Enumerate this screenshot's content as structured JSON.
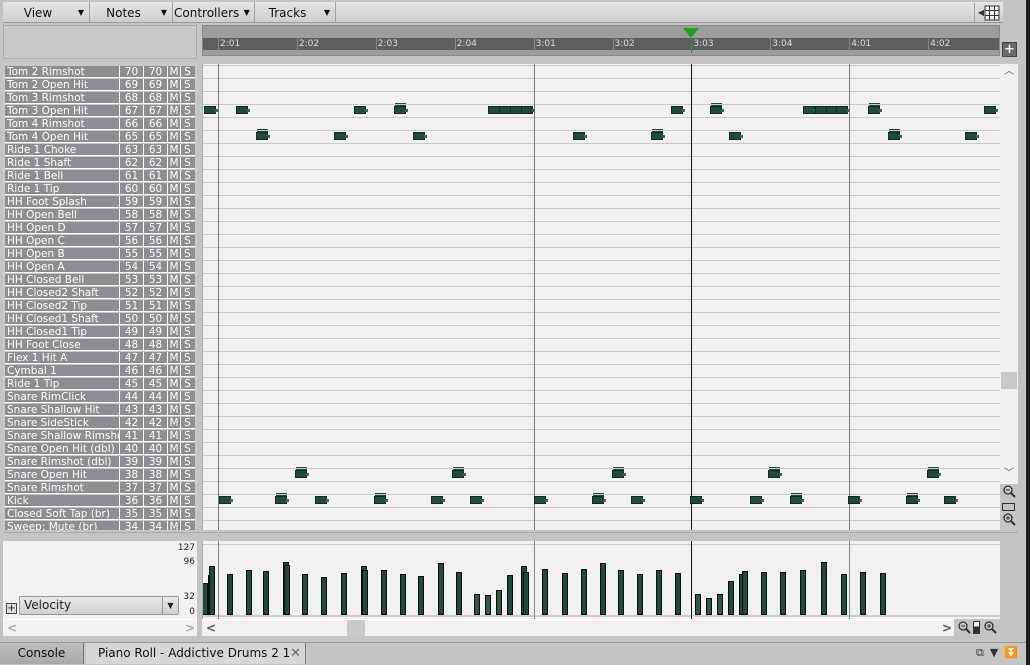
{
  "menubar": {
    "menus": [
      {
        "label": "View"
      },
      {
        "label": "Notes"
      },
      {
        "label": "Controllers"
      },
      {
        "label": "Tracks"
      }
    ]
  },
  "timeline": {
    "markers": [
      "2:01",
      "2:02",
      "2:03",
      "2:04",
      "3:01",
      "3:02",
      "3:03",
      "3:04",
      "4:01",
      "4:02"
    ],
    "playhead": "3:03",
    "playhead_color": "#1aa31a"
  },
  "keys": [
    {
      "name": "Tom 2 Rimshot",
      "n1": "70",
      "n2": "70",
      "m": "M",
      "s": "S"
    },
    {
      "name": "Tom 2 Open Hit",
      "n1": "69",
      "n2": "69",
      "m": "M",
      "s": "S"
    },
    {
      "name": "Tom 3 Rimshot",
      "n1": "68",
      "n2": "68",
      "m": "M",
      "s": "S"
    },
    {
      "name": "Tom 3 Open Hit",
      "n1": "67",
      "n2": "67",
      "m": "M",
      "s": "S"
    },
    {
      "name": "Tom 4 Rimshot",
      "n1": "66",
      "n2": "66",
      "m": "M",
      "s": "S"
    },
    {
      "name": "Tom 4 Open Hit",
      "n1": "65",
      "n2": "65",
      "m": "M",
      "s": "S"
    },
    {
      "name": "Ride 1 Choke",
      "n1": "63",
      "n2": "63",
      "m": "M",
      "s": "S"
    },
    {
      "name": "Ride 1 Shaft",
      "n1": "62",
      "n2": "62",
      "m": "M",
      "s": "S"
    },
    {
      "name": "Ride 1 Bell",
      "n1": "61",
      "n2": "61",
      "m": "M",
      "s": "S"
    },
    {
      "name": "Ride 1 Tip",
      "n1": "60",
      "n2": "60",
      "m": "M",
      "s": "S"
    },
    {
      "name": "HH Foot Splash",
      "n1": "59",
      "n2": "59",
      "m": "M",
      "s": "S"
    },
    {
      "name": "HH Open Bell",
      "n1": "58",
      "n2": "58",
      "m": "M",
      "s": "S"
    },
    {
      "name": "HH Open D",
      "n1": "57",
      "n2": "57",
      "m": "M",
      "s": "S"
    },
    {
      "name": "HH Open C",
      "n1": "56",
      "n2": "56",
      "m": "M",
      "s": "S"
    },
    {
      "name": "HH Open B",
      "n1": "55",
      "n2": "55",
      "m": "M",
      "s": "S"
    },
    {
      "name": "HH Open A",
      "n1": "54",
      "n2": "54",
      "m": "M",
      "s": "S"
    },
    {
      "name": "HH Closed Bell",
      "n1": "53",
      "n2": "53",
      "m": "M",
      "s": "S"
    },
    {
      "name": "HH Closed2 Shaft",
      "n1": "52",
      "n2": "52",
      "m": "M",
      "s": "S"
    },
    {
      "name": "HH Closed2 Tip",
      "n1": "51",
      "n2": "51",
      "m": "M",
      "s": "S"
    },
    {
      "name": "HH Closed1 Shaft",
      "n1": "50",
      "n2": "50",
      "m": "M",
      "s": "S"
    },
    {
      "name": "HH Closed1 Tip",
      "n1": "49",
      "n2": "49",
      "m": "M",
      "s": "S"
    },
    {
      "name": "HH Foot Close",
      "n1": "48",
      "n2": "48",
      "m": "M",
      "s": "S"
    },
    {
      "name": "Flex 1 Hit A",
      "n1": "47",
      "n2": "47",
      "m": "M",
      "s": "S"
    },
    {
      "name": "Cymbal 1",
      "n1": "46",
      "n2": "46",
      "m": "M",
      "s": "S"
    },
    {
      "name": "Ride 1 Tip",
      "n1": "45",
      "n2": "45",
      "m": "M",
      "s": "S"
    },
    {
      "name": "Snare RimClick",
      "n1": "44",
      "n2": "44",
      "m": "M",
      "s": "S"
    },
    {
      "name": "Snare Shallow Hit",
      "n1": "43",
      "n2": "43",
      "m": "M",
      "s": "S"
    },
    {
      "name": "Snare SideStick",
      "n1": "42",
      "n2": "42",
      "m": "M",
      "s": "S"
    },
    {
      "name": "Snare Shallow Rimshot",
      "n1": "41",
      "n2": "41",
      "m": "M",
      "s": "S"
    },
    {
      "name": "Snare Open Hit (dbl)",
      "n1": "40",
      "n2": "40",
      "m": "M",
      "s": "S"
    },
    {
      "name": "Snare Rimshot (dbl)",
      "n1": "39",
      "n2": "39",
      "m": "M",
      "s": "S"
    },
    {
      "name": "Snare Open Hit",
      "n1": "38",
      "n2": "38",
      "m": "M",
      "s": "S"
    },
    {
      "name": "Snare Rimshot",
      "n1": "37",
      "n2": "37",
      "m": "M",
      "s": "S"
    },
    {
      "name": "Kick",
      "n1": "36",
      "n2": "36",
      "m": "M",
      "s": "S"
    },
    {
      "name": "Closed Soft Tap (br)",
      "n1": "35",
      "n2": "35",
      "m": "M",
      "s": "S"
    },
    {
      "name": "Sweep: Mute (br)",
      "n1": "34",
      "n2": "34",
      "m": "M",
      "s": "S"
    }
  ],
  "notes": [
    {
      "row": 3,
      "beat": -0.17,
      "accent": false
    },
    {
      "row": 3,
      "beat": 0.24,
      "accent": false
    },
    {
      "row": 3,
      "beat": 1.74,
      "accent": false
    },
    {
      "row": 3,
      "beat": 2.24,
      "accent": true
    },
    {
      "row": 3,
      "beat": 3.43,
      "accent": false
    },
    {
      "row": 3,
      "beat": 3.57,
      "accent": false
    },
    {
      "row": 3,
      "beat": 3.71,
      "accent": false
    },
    {
      "row": 3,
      "beat": 3.85,
      "accent": false
    },
    {
      "row": 3,
      "beat": 5.75,
      "accent": false
    },
    {
      "row": 3,
      "beat": 6.25,
      "accent": true
    },
    {
      "row": 3,
      "beat": 7.43,
      "accent": false
    },
    {
      "row": 3,
      "beat": 7.58,
      "accent": false
    },
    {
      "row": 3,
      "beat": 7.72,
      "accent": false
    },
    {
      "row": 3,
      "beat": 7.85,
      "accent": false
    },
    {
      "row": 3,
      "beat": 8.25,
      "accent": true
    },
    {
      "row": 3,
      "beat": 9.72,
      "accent": false
    },
    {
      "row": 5,
      "beat": 0.5,
      "accent": true
    },
    {
      "row": 5,
      "beat": 1.48,
      "accent": false
    },
    {
      "row": 5,
      "beat": 2.48,
      "accent": false
    },
    {
      "row": 5,
      "beat": 4.51,
      "accent": false
    },
    {
      "row": 5,
      "beat": 5.5,
      "accent": true
    },
    {
      "row": 5,
      "beat": 6.49,
      "accent": false
    },
    {
      "row": 5,
      "beat": 8.5,
      "accent": true
    },
    {
      "row": 5,
      "beat": 9.48,
      "accent": false
    },
    {
      "row": 31,
      "beat": 0.99,
      "accent": true
    },
    {
      "row": 31,
      "beat": 2.98,
      "accent": true
    },
    {
      "row": 31,
      "beat": 5.0,
      "accent": true
    },
    {
      "row": 31,
      "beat": 6.98,
      "accent": true
    },
    {
      "row": 31,
      "beat": 9.0,
      "accent": true
    },
    {
      "row": 33,
      "beat": 0.02,
      "accent": false
    },
    {
      "row": 33,
      "beat": 0.74,
      "accent": true
    },
    {
      "row": 33,
      "beat": 1.24,
      "accent": false
    },
    {
      "row": 33,
      "beat": 1.99,
      "accent": true
    },
    {
      "row": 33,
      "beat": 2.71,
      "accent": false
    },
    {
      "row": 33,
      "beat": 3.21,
      "accent": false
    },
    {
      "row": 33,
      "beat": 4.02,
      "accent": false
    },
    {
      "row": 33,
      "beat": 4.75,
      "accent": true
    },
    {
      "row": 33,
      "beat": 5.25,
      "accent": false
    },
    {
      "row": 33,
      "beat": 6.0,
      "accent": false
    },
    {
      "row": 33,
      "beat": 6.76,
      "accent": false
    },
    {
      "row": 33,
      "beat": 7.26,
      "accent": true
    },
    {
      "row": 33,
      "beat": 8.0,
      "accent": false
    },
    {
      "row": 33,
      "beat": 8.73,
      "accent": true
    },
    {
      "row": 33,
      "beat": 9.22,
      "accent": false
    }
  ],
  "controller": {
    "lane": "Velocity",
    "y_labels": [
      "127",
      "96",
      "32",
      "0"
    ],
    "bars": [
      {
        "beat": -0.12,
        "v": 58,
        "light": false
      },
      {
        "beat": 0.03,
        "v": 73,
        "light": false
      },
      {
        "beat": 0.05,
        "v": 88,
        "light": false
      },
      {
        "beat": 0.5,
        "v": 75,
        "light": false
      },
      {
        "beat": 0.99,
        "v": 81,
        "light": false
      },
      {
        "beat": 1.43,
        "v": 79,
        "light": false
      },
      {
        "beat": 1.93,
        "v": 96,
        "light": false
      },
      {
        "beat": 1.95,
        "v": 90,
        "light": false
      },
      {
        "beat": 2.42,
        "v": 75,
        "light": false
      },
      {
        "beat": 2.9,
        "v": 69,
        "light": false
      },
      {
        "beat": 3.4,
        "v": 77,
        "light": false
      },
      {
        "beat": 3.9,
        "v": 88,
        "light": false
      },
      {
        "beat": 3.92,
        "v": 82,
        "light": false
      },
      {
        "beat": 4.41,
        "v": 81,
        "light": false
      },
      {
        "beat": 4.89,
        "v": 75,
        "light": false
      },
      {
        "beat": 5.34,
        "v": 71,
        "light": false
      },
      {
        "beat": 5.85,
        "v": 94,
        "light": false
      },
      {
        "beat": 6.3,
        "v": 78,
        "light": false
      },
      {
        "beat": 6.76,
        "v": 39,
        "light": true
      },
      {
        "beat": 7.04,
        "v": 37,
        "light": true
      },
      {
        "beat": 7.32,
        "v": 45,
        "light": true
      },
      {
        "beat": 7.6,
        "v": 73,
        "light": false
      },
      {
        "beat": 7.97,
        "v": 88,
        "light": false
      },
      {
        "beat": 8.0,
        "v": 78,
        "light": false
      },
      {
        "beat": 8.5,
        "v": 83,
        "light": false
      },
      {
        "beat": 8.99,
        "v": 77,
        "light": false
      },
      {
        "beat": 9.47,
        "v": 83,
        "light": false
      },
      {
        "beat": 9.95,
        "v": 95,
        "light": false
      },
      {
        "beat": 10.42,
        "v": 81,
        "light": false
      },
      {
        "beat": 10.9,
        "v": 75,
        "light": false
      },
      {
        "beat": 11.39,
        "v": 81,
        "light": false
      },
      {
        "beat": 11.87,
        "v": 77,
        "light": false
      },
      {
        "beat": 12.37,
        "v": 39,
        "light": true
      },
      {
        "beat": 12.66,
        "v": 31,
        "light": true
      },
      {
        "beat": 12.94,
        "v": 38,
        "light": true
      },
      {
        "beat": 13.2,
        "v": 61,
        "light": false
      },
      {
        "beat": 13.49,
        "v": 74,
        "light": false
      },
      {
        "beat": 13.56,
        "v": 79,
        "light": false
      },
      {
        "beat": 14.04,
        "v": 78,
        "light": false
      },
      {
        "beat": 14.53,
        "v": 78,
        "light": false
      },
      {
        "beat": 15.02,
        "v": 81,
        "light": false
      },
      {
        "beat": 15.57,
        "v": 96,
        "light": false
      },
      {
        "beat": 16.06,
        "v": 75,
        "light": false
      },
      {
        "beat": 16.56,
        "v": 78,
        "light": false
      },
      {
        "beat": 17.06,
        "v": 77,
        "light": false
      }
    ]
  },
  "tabs": [
    {
      "label": "Console"
    },
    {
      "label": "Piano Roll - Addictive Drums 2 1",
      "close": "✕"
    }
  ],
  "icons": {
    "grid": "grid-icon",
    "zoom_out": "zoom-out-icon",
    "zoom_in": "zoom-in-icon"
  }
}
